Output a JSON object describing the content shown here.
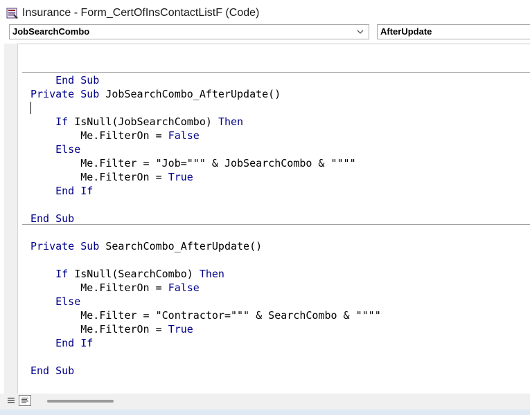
{
  "window": {
    "title": "Insurance - Form_CertOfInsContactListF (Code)"
  },
  "object_combo": {
    "value": "JobSearchCombo"
  },
  "procedure_combo": {
    "value": "AfterUpdate"
  },
  "code": {
    "l1_kw": "End Sub",
    "l2_kw": "Private Sub",
    "l2_rest": " JobSearchCombo_AfterUpdate()",
    "l3_kw1": "If",
    "l3_mid": " IsNull(JobSearchCombo) ",
    "l3_kw2": "Then",
    "l4_pre": "Me.FilterOn = ",
    "l4_kw": "False",
    "l5_kw": "Else",
    "l6_text": "Me.Filter = \"Job=\"\"\" & JobSearchCombo & \"\"\"\"",
    "l7_pre": "Me.FilterOn = ",
    "l7_kw": "True",
    "l8_kw": "End If",
    "l9_kw": "End Sub",
    "l10_kw": "Private Sub",
    "l10_rest": " SearchCombo_AfterUpdate()",
    "l11_kw1": "If",
    "l11_mid": " IsNull(SearchCombo) ",
    "l11_kw2": "Then",
    "l12_pre": "Me.FilterOn = ",
    "l12_kw": "False",
    "l13_kw": "Else",
    "l14_text": "Me.Filter = \"Contractor=\"\"\" & SearchCombo & \"\"\"\"",
    "l15_pre": "Me.FilterOn = ",
    "l15_kw": "True",
    "l16_kw": "End If",
    "l17_kw": "End Sub"
  },
  "colors": {
    "keyword": "#00008b",
    "text": "#000000"
  },
  "icons": {
    "app": "access-form-icon",
    "combo_dropdown": "chevron-down-icon",
    "procedure_view": "procedure-view-icon",
    "full_module_view": "full-module-view-icon"
  }
}
